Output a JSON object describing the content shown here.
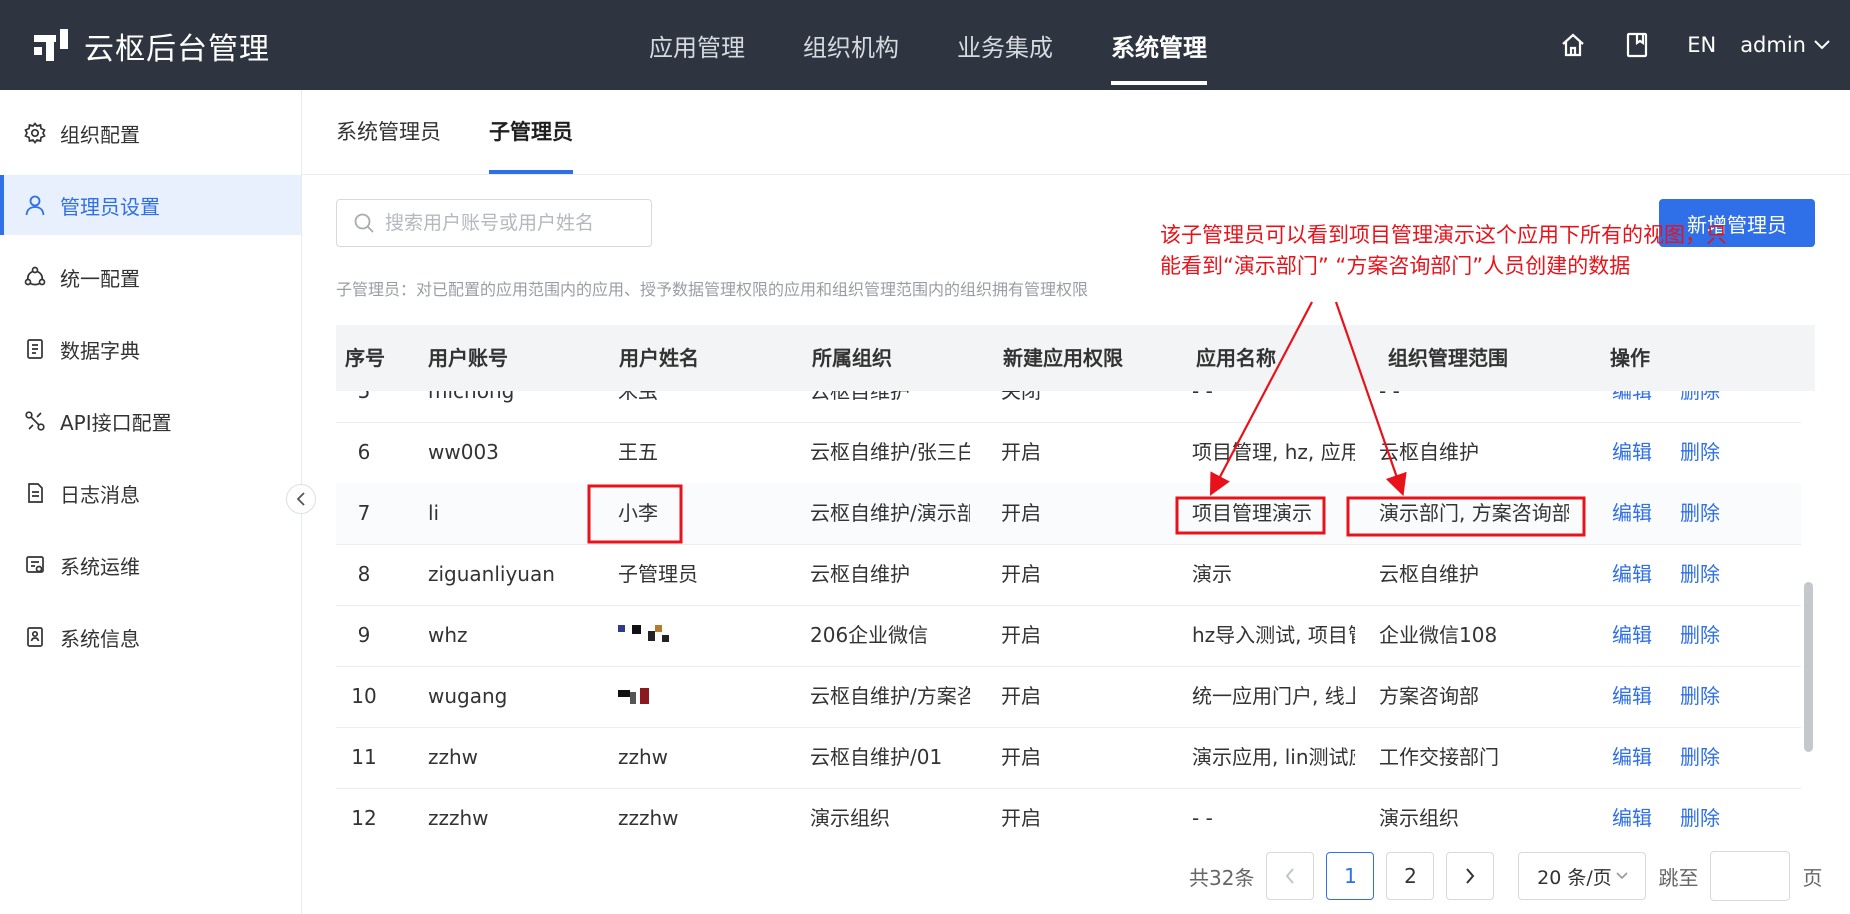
{
  "header": {
    "brand": "云枢后台管理",
    "nav": [
      {
        "label": "应用管理",
        "active": false
      },
      {
        "label": "组织机构",
        "active": false
      },
      {
        "label": "业务集成",
        "active": false
      },
      {
        "label": "系统管理",
        "active": true
      }
    ],
    "lang": "EN",
    "user": "admin"
  },
  "sidebar": {
    "items": [
      {
        "label": "组织配置",
        "icon": "gear-icon",
        "active": false
      },
      {
        "label": "管理员设置",
        "icon": "user-icon",
        "active": true
      },
      {
        "label": "统一配置",
        "icon": "cycle-icon",
        "active": false
      },
      {
        "label": "数据字典",
        "icon": "dictionary-icon",
        "active": false
      },
      {
        "label": "API接口配置",
        "icon": "api-icon",
        "active": false
      },
      {
        "label": "日志消息",
        "icon": "log-icon",
        "active": false
      },
      {
        "label": "系统运维",
        "icon": "maintenance-icon",
        "active": false
      },
      {
        "label": "系统信息",
        "icon": "info-icon",
        "active": false
      }
    ]
  },
  "tabs": [
    {
      "label": "系统管理员",
      "active": false
    },
    {
      "label": "子管理员",
      "active": true
    }
  ],
  "search": {
    "placeholder": "搜索用户账号或用户姓名",
    "value": ""
  },
  "add_button": "新增管理员",
  "note": "子管理员：对已配置的应用范围内的应用、授予数据管理权限的应用和组织管理范围内的组织拥有管理权限",
  "table": {
    "columns": [
      "序号",
      "用户账号",
      "用户姓名",
      "所属组织",
      "新建应用权限",
      "应用名称",
      "组织管理范围",
      "操作"
    ],
    "edit_label": "编辑",
    "delete_label": "删除",
    "rows": [
      {
        "idx": "5",
        "account": "michong",
        "name": "米虫",
        "org": "云枢自维护",
        "perm": "关闭",
        "app": "- -",
        "scope": "- -"
      },
      {
        "idx": "6",
        "account": "ww003",
        "name": "王五",
        "org": "云枢自维护/张三白",
        "perm": "开启",
        "app": "项目管理, hz, 应用",
        "scope": "云枢自维护"
      },
      {
        "idx": "7",
        "account": "li",
        "name": "小李",
        "org": "云枢自维护/演示部门",
        "perm": "开启",
        "app": "项目管理演示",
        "scope": "演示部门, 方案咨询部门"
      },
      {
        "idx": "8",
        "account": "ziguanliyuan",
        "name": "子管理员",
        "org": "云枢自维护",
        "perm": "开启",
        "app": "演示",
        "scope": "云枢自维护"
      },
      {
        "idx": "9",
        "account": "whz",
        "name": "",
        "org": "206企业微信",
        "perm": "开启",
        "app": "hz导入测试, 项目管理",
        "scope": "企业微信108"
      },
      {
        "idx": "10",
        "account": "wugang",
        "name": "",
        "org": "云枢自维护/方案咨询",
        "perm": "开启",
        "app": "统一应用门户, 线上",
        "scope": "方案咨询部"
      },
      {
        "idx": "11",
        "account": "zzhw",
        "name": "zzhw",
        "org": "云枢自维护/01",
        "perm": "开启",
        "app": "演示应用, lin测试应用",
        "scope": "工作交接部门"
      },
      {
        "idx": "12",
        "account": "zzzhw",
        "name": "zzzhw",
        "org": "演示组织",
        "perm": "开启",
        "app": "- -",
        "scope": "演示组织"
      }
    ]
  },
  "annotation": {
    "text": "该子管理员可以看到项目管理演示这个应用下所有的视图，只能看到“演示部门” “方案咨询部门”人员创建的数据",
    "color": "#e8121a"
  },
  "pagination": {
    "total": "共32条",
    "pages": [
      "1",
      "2"
    ],
    "current": "1",
    "page_size": "20 条/页",
    "jump_label": "跳至",
    "page_unit": "页"
  },
  "colors": {
    "accent": "#2f6fe8",
    "topbar": "#2f3540"
  }
}
